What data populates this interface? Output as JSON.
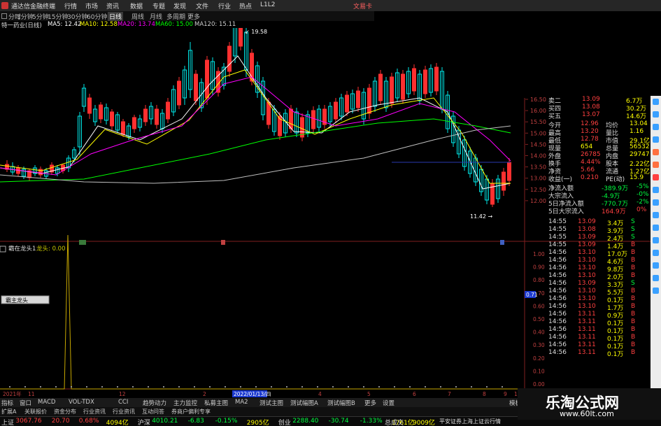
{
  "window": {
    "title": "通达信金融终端"
  },
  "menu": [
    "行情",
    "市场",
    "资讯",
    "数据",
    "专题",
    "发现",
    "文件",
    "行业",
    "热点",
    "L1L2"
  ],
  "menu_right": "文易卡",
  "periods": [
    "分时",
    "1分钟",
    "5分钟",
    "15分钟",
    "30分钟",
    "60分钟",
    "日线",
    "周线",
    "月线",
    "多周期",
    "更多"
  ],
  "stock": {
    "name_label": "特一药业(日线)"
  },
  "ma_legend": [
    {
      "label": "MA5: 12.42",
      "color": "#ffffff"
    },
    {
      "label": "MA10: 12.58",
      "color": "#ffff00"
    },
    {
      "label": "MA20: 13.74",
      "color": "#ff00ff"
    },
    {
      "label": "MA60: 15.00",
      "color": "#00ff00"
    },
    {
      "label": "MA120: 15.11",
      "color": "#d0d0d0"
    }
  ],
  "price_axis": [
    "16.50",
    "16.00",
    "15.50",
    "15.00",
    "14.50",
    "14.00",
    "13.50",
    "13.00",
    "12.50",
    "12.00"
  ],
  "annotations": {
    "high": "19.58",
    "low": "11.42"
  },
  "indicator": {
    "name": "霸在龙头1",
    "sub": "龙头: 0.00",
    "popup": "霸主龙头"
  },
  "indicator_axis": [
    "1.00",
    "0.90",
    "0.80",
    "0.70",
    "0.60",
    "0.50",
    "0.40",
    "0.30",
    "0.20",
    "0.10",
    "0.00"
  ],
  "indicator_marker": "0.71",
  "date_axis": [
    "2021年",
    "11",
    "12",
    "2",
    "3",
    "4",
    "5",
    "6",
    "7",
    "8",
    "9",
    "10",
    "11"
  ],
  "date_highlight": "2022/01/13/四",
  "order_book": [
    {
      "label": "卖二",
      "price": "13.09",
      "vol": "6.7万"
    },
    {
      "label": "买四",
      "price": "13.08",
      "vol": "30.2万"
    },
    {
      "label": "买五",
      "price": "13.07",
      "vol": "14.6万"
    }
  ],
  "stats": [
    {
      "l1": "今开",
      "v1": "12.96",
      "l2": "均价",
      "v2": "13.04"
    },
    {
      "l1": "最高",
      "v1": "13.20",
      "l2": "量比",
      "v2": "1.16"
    },
    {
      "l1": "最低",
      "v1": "12.78",
      "l2": "市值",
      "v2": "29.1亿"
    },
    {
      "l1": "现量",
      "v1": "654",
      "l2": "总量",
      "v2": "56532"
    },
    {
      "l1": "外盘",
      "v1": "26785",
      "l2": "内盘",
      "v2": "29747"
    },
    {
      "l1": "换手",
      "v1": "4.44%",
      "l2": "股本",
      "v2": "2.22亿"
    },
    {
      "l1": "净资",
      "v1": "5.66",
      "l2": "流通",
      "v2": "1.27亿"
    },
    {
      "l1": "收益(一)",
      "v1": "0.210",
      "l2": "PE(动)",
      "v2": "15.9"
    }
  ],
  "flows": [
    {
      "label": "净流入额",
      "value": "-389.9万",
      "pct": "-5%"
    },
    {
      "label": "大宗流入",
      "value": "-4.9万",
      "pct": "-0%"
    },
    {
      "label": "5日净流入额",
      "value": "-770.7万",
      "pct": "-2%"
    },
    {
      "label": "5日大宗流入",
      "value": "164.9万",
      "pct": "0%"
    }
  ],
  "ticks": [
    {
      "t": "14:55",
      "p": "13.09",
      "v": "3.4万",
      "d": "S"
    },
    {
      "t": "14:55",
      "p": "13.08",
      "v": "3.9万",
      "d": "S"
    },
    {
      "t": "14:55",
      "p": "13.09",
      "v": "2.4万",
      "d": "S"
    },
    {
      "t": "14:55",
      "p": "13.09",
      "v": "1.4万",
      "d": "B"
    },
    {
      "t": "14:56",
      "p": "13.10",
      "v": "17.0万",
      "d": "B"
    },
    {
      "t": "14:56",
      "p": "13.10",
      "v": "4.6万",
      "d": "B"
    },
    {
      "t": "14:56",
      "p": "13.10",
      "v": "9.8万",
      "d": "B"
    },
    {
      "t": "14:56",
      "p": "13.10",
      "v": "2.0万",
      "d": "B"
    },
    {
      "t": "14:56",
      "p": "13.09",
      "v": "3.3万",
      "d": "S"
    },
    {
      "t": "14:56",
      "p": "13.10",
      "v": "5.5万",
      "d": "B"
    },
    {
      "t": "14:56",
      "p": "13.10",
      "v": "0.1万",
      "d": "B"
    },
    {
      "t": "14:56",
      "p": "13.10",
      "v": "1.7万",
      "d": "B"
    },
    {
      "t": "14:56",
      "p": "13.11",
      "v": "0.9万",
      "d": "B"
    },
    {
      "t": "14:56",
      "p": "13.11",
      "v": "0.1万",
      "d": "B"
    },
    {
      "t": "14:56",
      "p": "13.11",
      "v": "0.1万",
      "d": "B"
    },
    {
      "t": "14:56",
      "p": "13.11",
      "v": "0.1万",
      "d": "B"
    },
    {
      "t": "14:56",
      "p": "13.11",
      "v": "0.1万",
      "d": "B"
    },
    {
      "t": "14:56",
      "p": "13.11",
      "v": "0.1万",
      "d": "B"
    }
  ],
  "bottom_tabs": [
    "指标",
    "窗口",
    "MACD",
    "VOL-TDX",
    "CCI",
    "趋势动力",
    "主力监控",
    "私募主图",
    "MA2",
    "测试主图",
    "测试幅图A",
    "测试幅图B",
    "更多",
    "设置"
  ],
  "bottom_tabs_right": "模板",
  "subtabs": [
    "扩展A",
    "关联报价",
    "资金分布",
    "行业资讯",
    "行业资讯",
    "互动问答",
    "券商户偏利专享"
  ],
  "tickers": [
    {
      "name": "上证",
      "value": "3067.76",
      "chg": "20.70",
      "pct": "0.68%",
      "amt": "4094亿",
      "color": "#ff4040"
    },
    {
      "name": "沪深",
      "value": "4010.21",
      "chg": "-6.83",
      "pct": "-0.15%",
      "amt": "2905亿",
      "color": "#00ff40"
    },
    {
      "name": "创业",
      "value": "2288.40",
      "chg": "-30.74",
      "pct": "-1.33%",
      "amt": "1761亿",
      "color": "#00ff40"
    }
  ],
  "total_label": "总成交",
  "total_value": "9009亿",
  "broker": "平安证券上海上证云行情",
  "brand": {
    "name": "乐淘公式网",
    "url": "www.60lt.com"
  }
}
